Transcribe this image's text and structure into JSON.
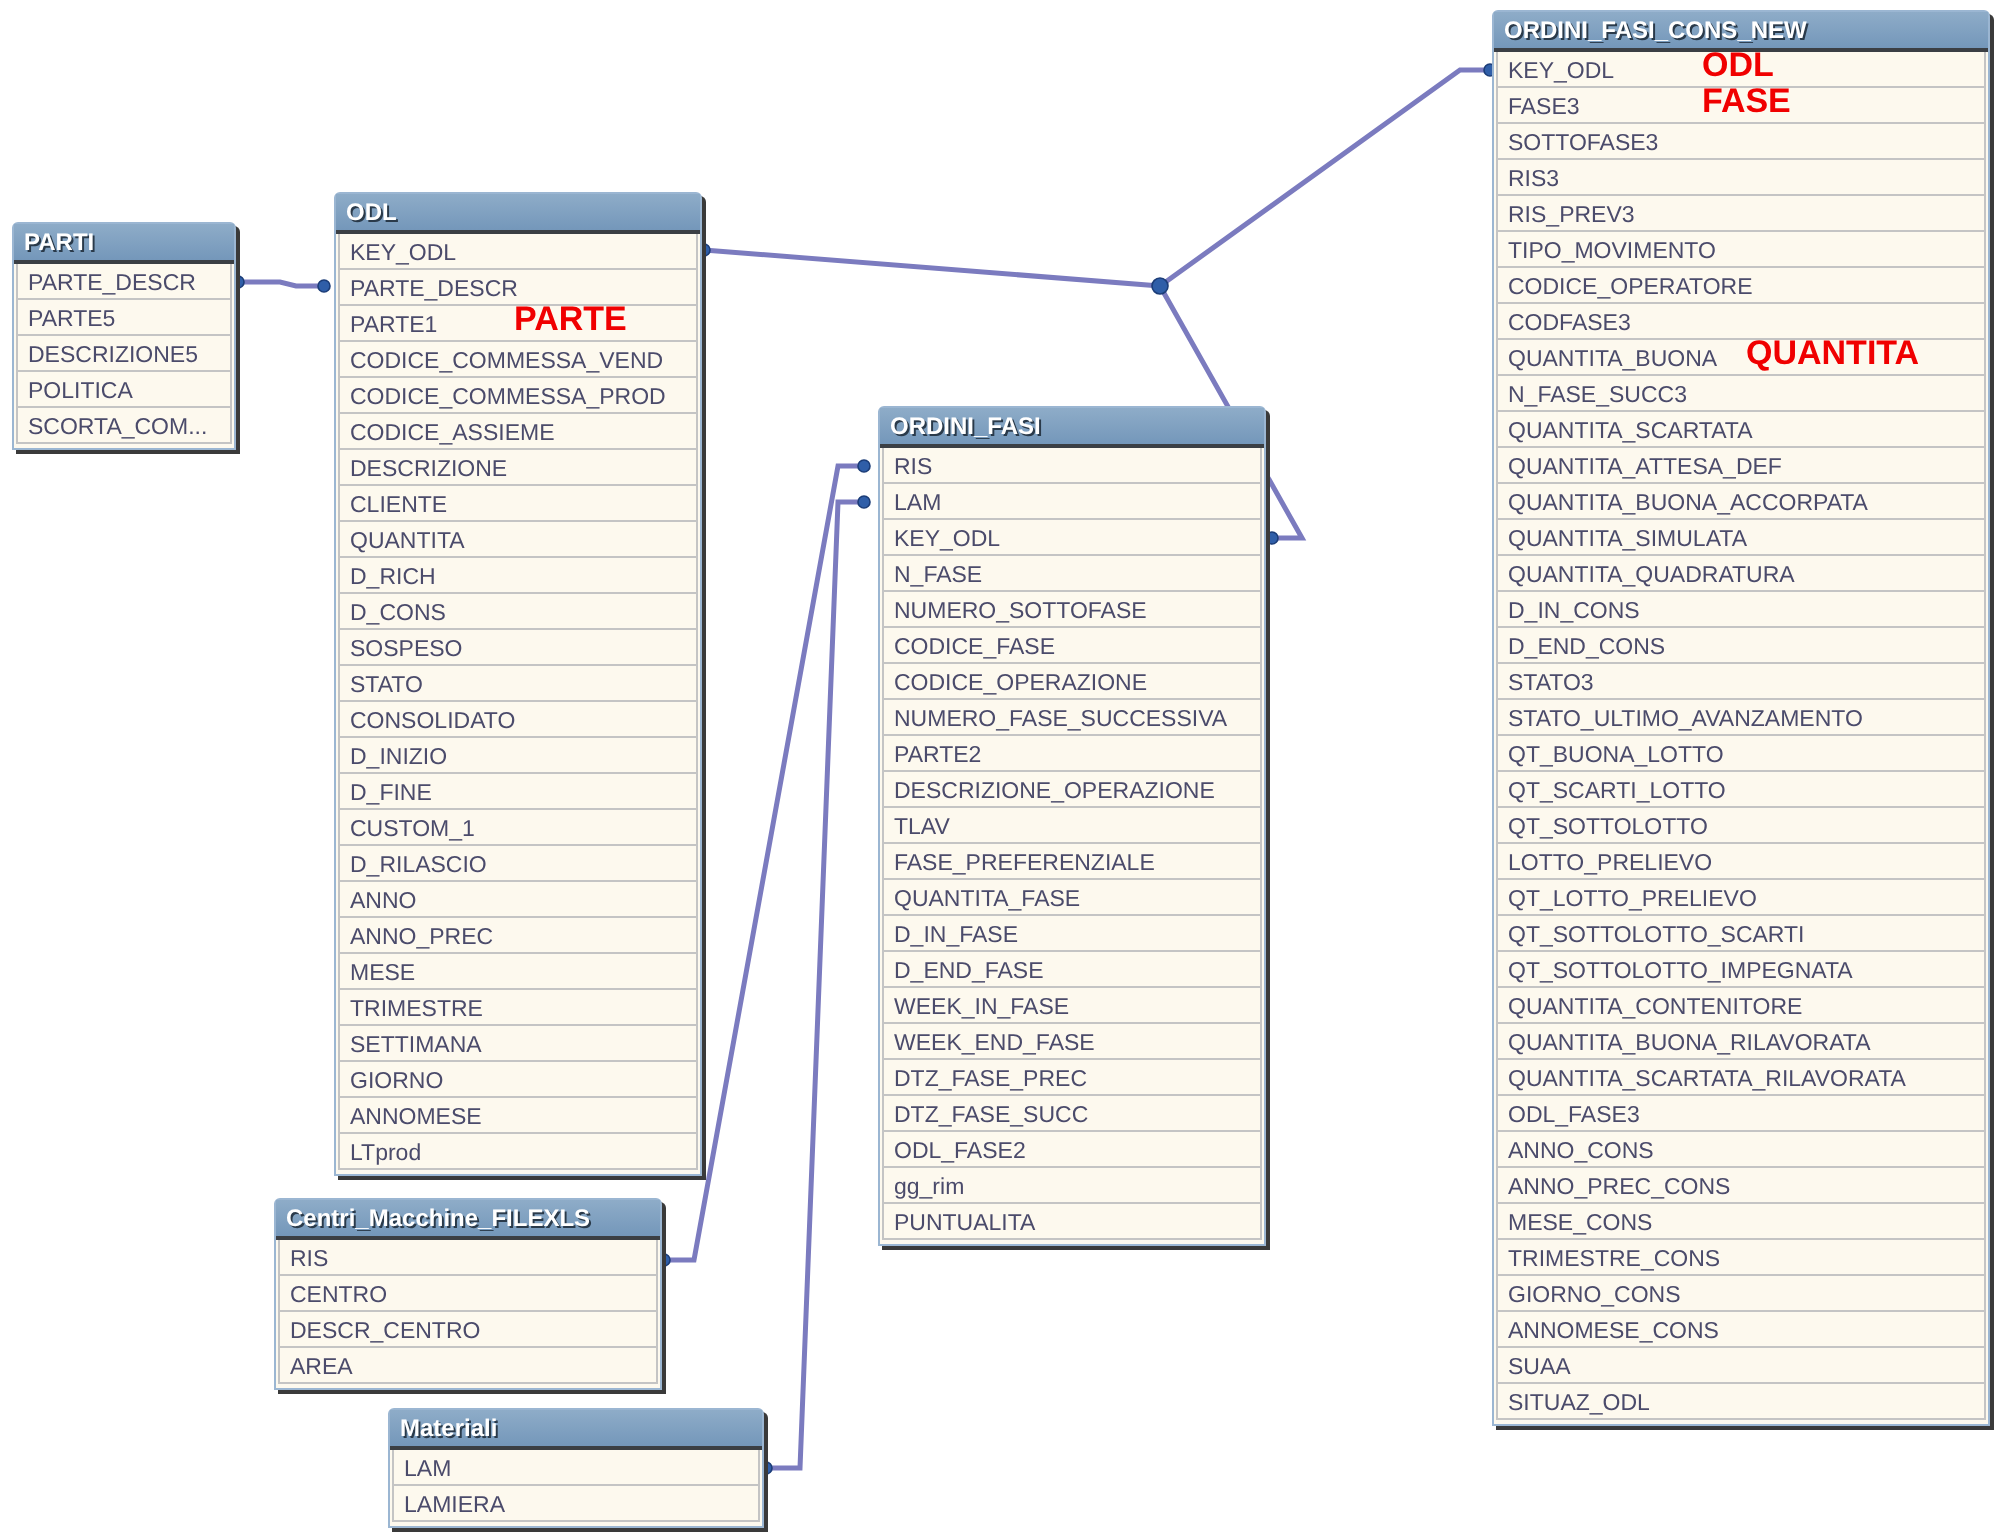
{
  "tables": [
    {
      "title": "PARTI",
      "fields": [
        {
          "name": "PARTE_DESCR"
        },
        {
          "name": "PARTE5"
        },
        {
          "name": "DESCRIZIONE5"
        },
        {
          "name": "POLITICA"
        },
        {
          "name": "SCORTA_COM..."
        }
      ]
    },
    {
      "title": "ODL",
      "fields": [
        {
          "name": "KEY_ODL"
        },
        {
          "name": "PARTE_DESCR"
        },
        {
          "name": "PARTE1",
          "note": "PARTE"
        },
        {
          "name": "CODICE_COMMESSA_VEND"
        },
        {
          "name": "CODICE_COMMESSA_PROD"
        },
        {
          "name": "CODICE_ASSIEME"
        },
        {
          "name": "DESCRIZIONE"
        },
        {
          "name": "CLIENTE"
        },
        {
          "name": "QUANTITA"
        },
        {
          "name": "D_RICH"
        },
        {
          "name": "D_CONS"
        },
        {
          "name": "SOSPESO"
        },
        {
          "name": "STATO"
        },
        {
          "name": "CONSOLIDATO"
        },
        {
          "name": "D_INIZIO"
        },
        {
          "name": "D_FINE"
        },
        {
          "name": "CUSTOM_1"
        },
        {
          "name": "D_RILASCIO"
        },
        {
          "name": "ANNO"
        },
        {
          "name": "ANNO_PREC"
        },
        {
          "name": "MESE"
        },
        {
          "name": "TRIMESTRE"
        },
        {
          "name": "SETTIMANA"
        },
        {
          "name": "GIORNO"
        },
        {
          "name": "ANNOMESE"
        },
        {
          "name": "LTprod"
        }
      ]
    },
    {
      "title": "ORDINI_FASI",
      "fields": [
        {
          "name": "RIS"
        },
        {
          "name": "LAM"
        },
        {
          "name": "KEY_ODL"
        },
        {
          "name": "N_FASE"
        },
        {
          "name": "NUMERO_SOTTOFASE"
        },
        {
          "name": "CODICE_FASE"
        },
        {
          "name": "CODICE_OPERAZIONE"
        },
        {
          "name": "NUMERO_FASE_SUCCESSIVA"
        },
        {
          "name": "PARTE2"
        },
        {
          "name": "DESCRIZIONE_OPERAZIONE"
        },
        {
          "name": "TLAV"
        },
        {
          "name": "FASE_PREFERENZIALE"
        },
        {
          "name": "QUANTITA_FASE"
        },
        {
          "name": "D_IN_FASE"
        },
        {
          "name": "D_END_FASE"
        },
        {
          "name": "WEEK_IN_FASE"
        },
        {
          "name": "WEEK_END_FASE"
        },
        {
          "name": "DTZ_FASE_PREC"
        },
        {
          "name": "DTZ_FASE_SUCC"
        },
        {
          "name": "ODL_FASE2"
        },
        {
          "name": "gg_rim"
        },
        {
          "name": "PUNTUALITA"
        }
      ]
    },
    {
      "title": "ORDINI_FASI_CONS_NEW",
      "fields": [
        {
          "name": "KEY_ODL",
          "note": "ODL"
        },
        {
          "name": "FASE3",
          "note": "FASE"
        },
        {
          "name": "SOTTOFASE3"
        },
        {
          "name": "RIS3"
        },
        {
          "name": "RIS_PREV3"
        },
        {
          "name": "TIPO_MOVIMENTO"
        },
        {
          "name": "CODICE_OPERATORE"
        },
        {
          "name": "CODFASE3"
        },
        {
          "name": "QUANTITA_BUONA",
          "note": "QUANTITA"
        },
        {
          "name": "N_FASE_SUCC3"
        },
        {
          "name": "QUANTITA_SCARTATA"
        },
        {
          "name": "QUANTITA_ATTESA_DEF"
        },
        {
          "name": "QUANTITA_BUONA_ACCORPATA"
        },
        {
          "name": "QUANTITA_SIMULATA"
        },
        {
          "name": "QUANTITA_QUADRATURA"
        },
        {
          "name": "D_IN_CONS"
        },
        {
          "name": "D_END_CONS"
        },
        {
          "name": "STATO3"
        },
        {
          "name": "STATO_ULTIMO_AVANZAMENTO"
        },
        {
          "name": "QT_BUONA_LOTTO"
        },
        {
          "name": "QT_SCARTI_LOTTO"
        },
        {
          "name": "QT_SOTTOLOTTO"
        },
        {
          "name": "LOTTO_PRELIEVO"
        },
        {
          "name": "QT_LOTTO_PRELIEVO"
        },
        {
          "name": "QT_SOTTOLOTTO_SCARTI"
        },
        {
          "name": "QT_SOTTOLOTTO_IMPEGNATA"
        },
        {
          "name": "QUANTITA_CONTENITORE"
        },
        {
          "name": "QUANTITA_BUONA_RILAVORATA"
        },
        {
          "name": "QUANTITA_SCARTATA_RILAVORATA"
        },
        {
          "name": "ODL_FASE3"
        },
        {
          "name": "ANNO_CONS"
        },
        {
          "name": "ANNO_PREC_CONS"
        },
        {
          "name": "MESE_CONS"
        },
        {
          "name": "TRIMESTRE_CONS"
        },
        {
          "name": "GIORNO_CONS"
        },
        {
          "name": "ANNOMESE_CONS"
        },
        {
          "name": "SUAA"
        },
        {
          "name": "SITUAZ_ODL"
        }
      ]
    },
    {
      "title": "Centri_Macchine_FILEXLS",
      "fields": [
        {
          "name": "RIS"
        },
        {
          "name": "CENTRO"
        },
        {
          "name": "DESCR_CENTRO"
        },
        {
          "name": "AREA"
        }
      ]
    },
    {
      "title": "Materiali",
      "fields": [
        {
          "name": "LAM"
        },
        {
          "name": "LAMIERA"
        }
      ]
    }
  ]
}
